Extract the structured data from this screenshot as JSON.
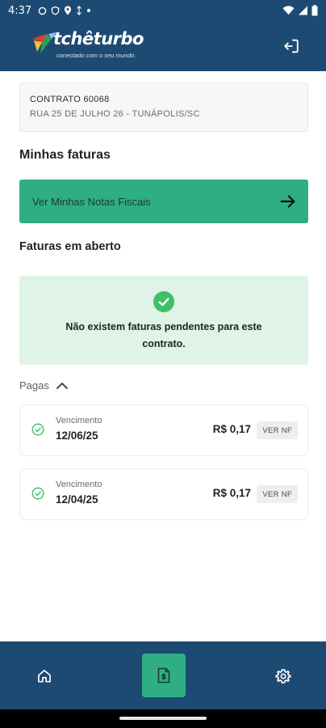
{
  "status_bar": {
    "time": "4:37",
    "left_icons": [
      "notification-icon",
      "shield-icon",
      "location-icon",
      "sync-icon",
      "dot-icon"
    ],
    "right_icons": [
      "wifi-icon",
      "signal-icon",
      "battery-icon"
    ]
  },
  "header": {
    "logo_name": "tchêturbo",
    "logo_tagline": "conectado com o seu mundo.",
    "logout_icon": "logout-icon"
  },
  "contract": {
    "title": "CONTRATO 60068",
    "address": "RUA 25 DE JULHO 26 - TUNÁPOLIS/SC"
  },
  "invoices_section": {
    "title": "Minhas faturas",
    "notas_button": "Ver Minhas Notas Fiscais"
  },
  "open_section": {
    "title": "Faturas em aberto",
    "empty_message": "Não existem faturas pendentes para este contrato."
  },
  "paid_section": {
    "toggle_label": "Pagas",
    "expanded": true,
    "invoices": [
      {
        "label": "Vencimento",
        "date": "12/06/25",
        "amount": "R$ 0,17",
        "button": "VER NF"
      },
      {
        "label": "Vencimento",
        "date": "12/04/25",
        "amount": "R$ 0,17",
        "button": "VER NF"
      }
    ]
  },
  "bottom_nav": {
    "items": [
      "home-icon",
      "invoice-icon",
      "settings-icon"
    ],
    "active": "invoice-icon"
  },
  "colors": {
    "primary": "#1d4a73",
    "accent": "#2fae86",
    "success_bg": "#dff3e7",
    "check": "#3fbf6a"
  }
}
